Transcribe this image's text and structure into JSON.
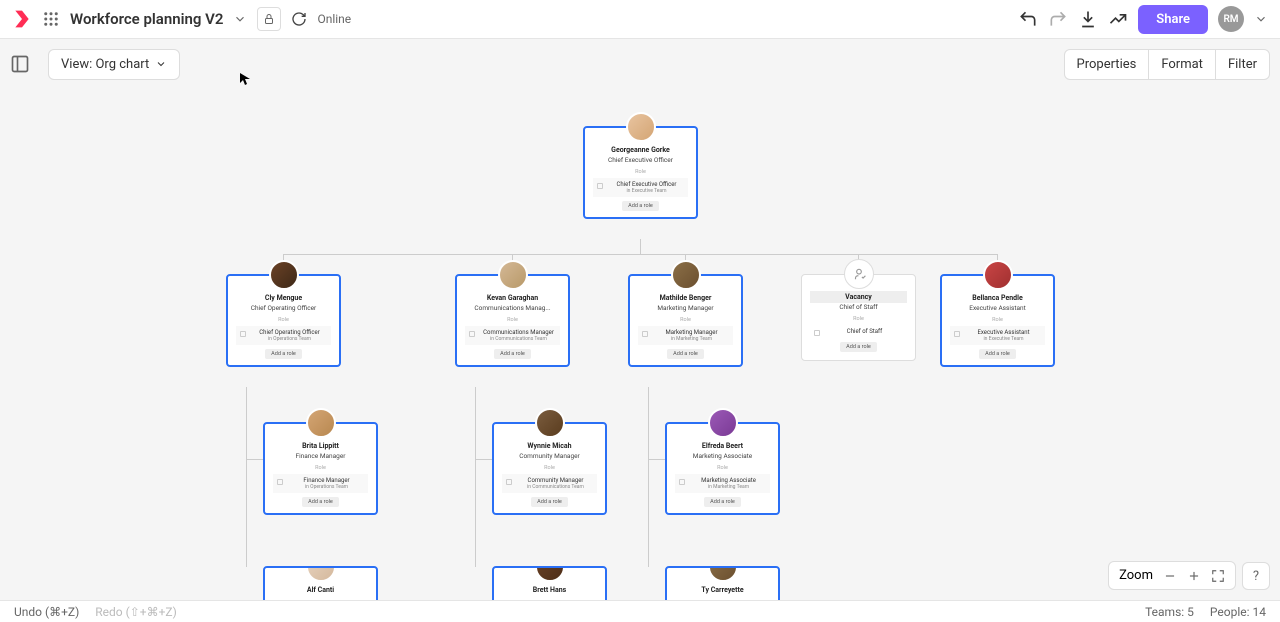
{
  "header": {
    "title": "Workforce planning V2",
    "online": "Online",
    "share": "Share",
    "user_initials": "RM"
  },
  "toolbar": {
    "view": "View: Org chart",
    "properties": "Properties",
    "format": "Format",
    "filter": "Filter"
  },
  "cards": {
    "ceo": {
      "name": "Georgeanne Gorke",
      "title": "Chief Executive Officer",
      "role_label": "Role",
      "role": "Chief Executive Officer",
      "team": "in Executive Team",
      "add": "Add a role"
    },
    "coo": {
      "name": "Cly Mengue",
      "title": "Chief Operating Officer",
      "role_label": "Role",
      "role": "Chief Operating Officer",
      "team": "in Operations Team",
      "add": "Add a role"
    },
    "comms": {
      "name": "Kevan Garaghan",
      "title": "Communications Manag...",
      "role_label": "Role",
      "role": "Communications Manager",
      "team": "in Communications Team",
      "add": "Add a role"
    },
    "mkt": {
      "name": "Mathilde Benger",
      "title": "Marketing Manager",
      "role_label": "Role",
      "role": "Marketing Manager",
      "team": "in Marketing Team",
      "add": "Add a role"
    },
    "vacancy": {
      "name": "Vacancy",
      "title": "Chief of Staff",
      "role_label": "Role",
      "role": "Chief of Staff",
      "team": "",
      "add": "Add a role"
    },
    "ea": {
      "name": "Bellanca Pendle",
      "title": "Executive Assistant",
      "role_label": "Role",
      "role": "Executive Assistant",
      "team": "in Executive Team",
      "add": "Add a role"
    },
    "fin": {
      "name": "Brita Lippitt",
      "title": "Finance Manager",
      "role_label": "Role",
      "role": "Finance Manager",
      "team": "in Operations Team",
      "add": "Add a role"
    },
    "comm2": {
      "name": "Wynnie Micah",
      "title": "Community Manager",
      "role_label": "Role",
      "role": "Community Manager",
      "team": "in Communications Team",
      "add": "Add a role"
    },
    "mkt2": {
      "name": "Elfreda Beert",
      "title": "Marketing Associate",
      "role_label": "Role",
      "role": "Marketing Associate",
      "team": "in Marketing Team",
      "add": "Add a role"
    },
    "r3a": {
      "name": "Alf Canti"
    },
    "r3b": {
      "name": "Brett Hans"
    },
    "r3c": {
      "name": "Ty Carreyette"
    }
  },
  "zoom": {
    "label": "Zoom"
  },
  "help": "?",
  "footer": {
    "undo": "Undo (⌘+Z)",
    "redo": "Redo (⇧+⌘+Z)",
    "teams": "Teams: 5",
    "people": "People: 14"
  }
}
